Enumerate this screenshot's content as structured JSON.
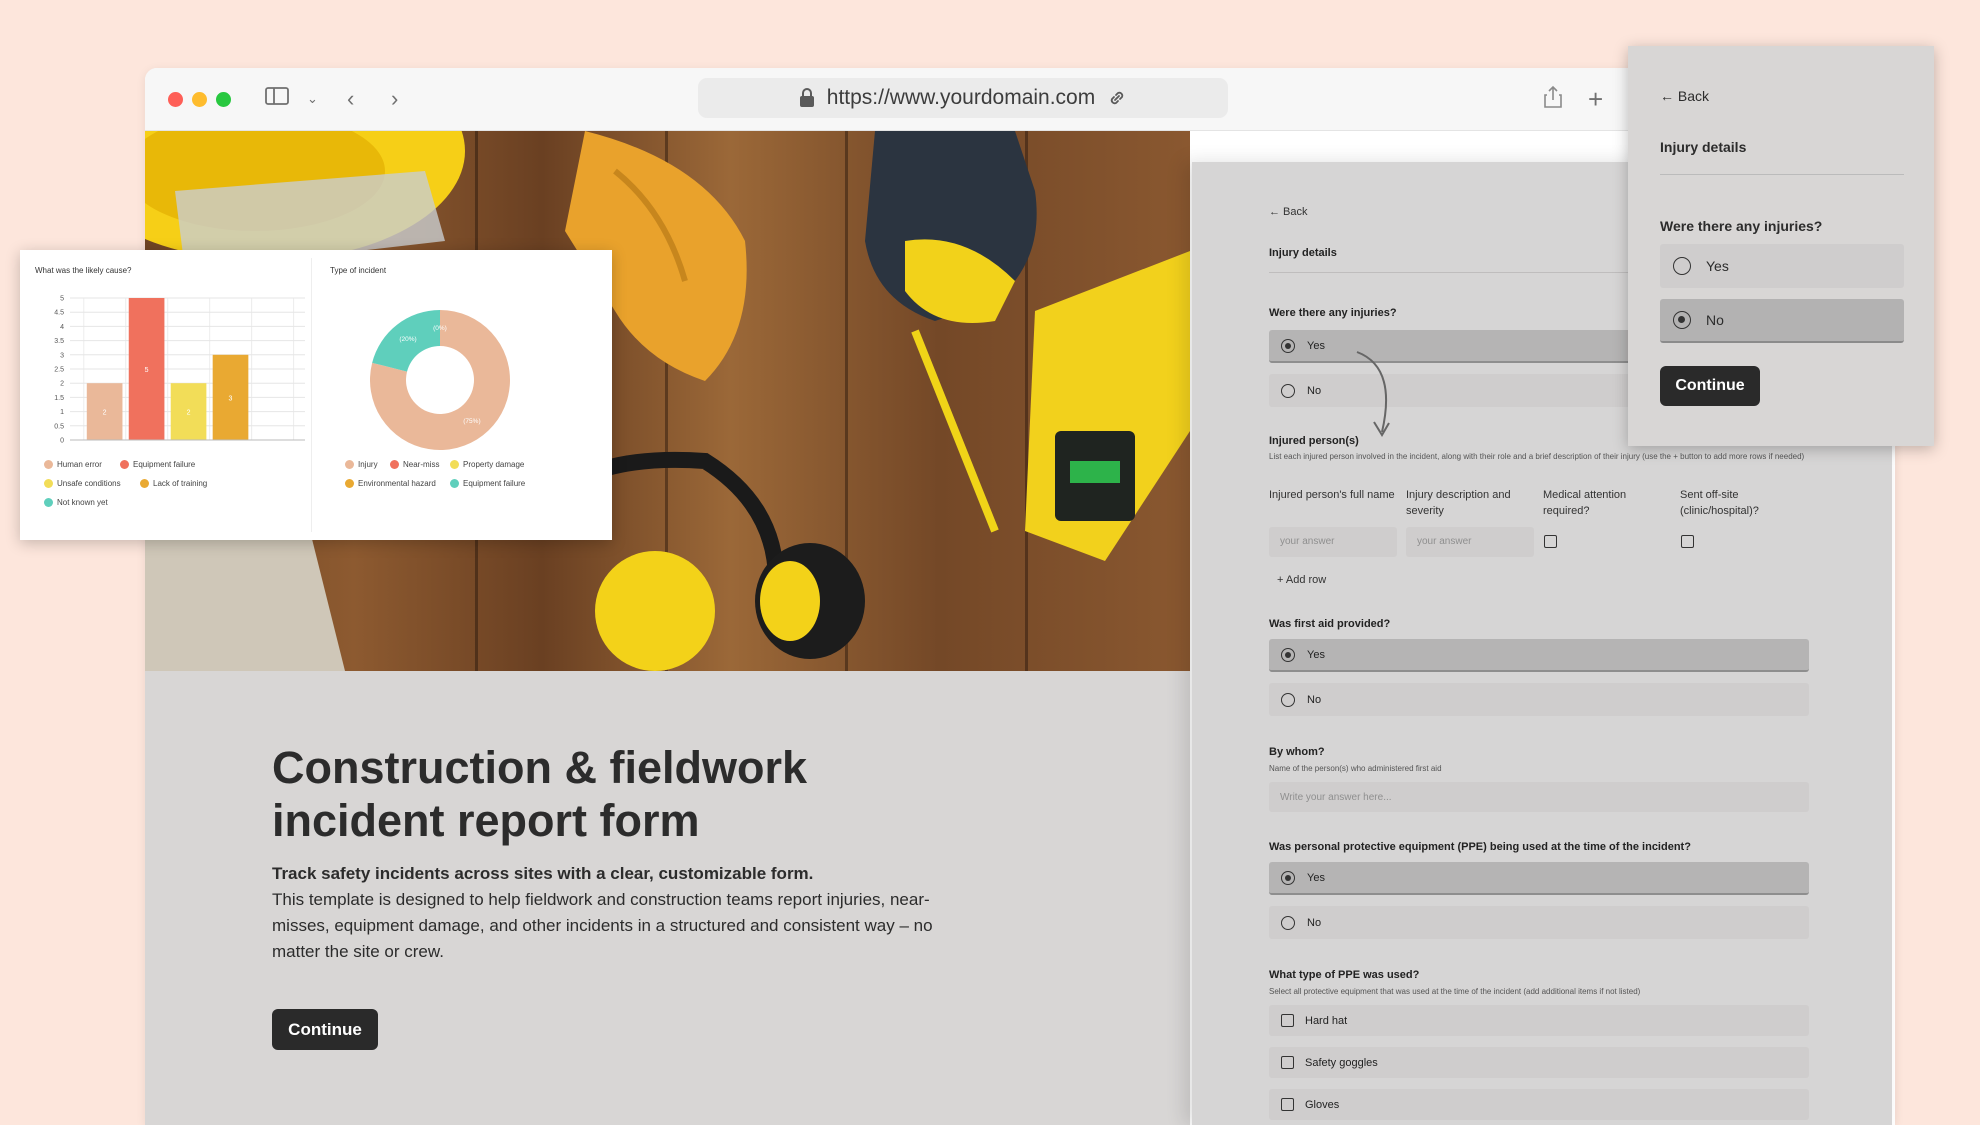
{
  "browser": {
    "url": "https://www.yourdomain.com"
  },
  "landing": {
    "title": "Construction & fieldwork incident report form",
    "subtitle": "Track safety incidents across sites with a clear, customizable form.",
    "description": "This template is designed to help fieldwork and construction teams report injuries, near-misses, equipment damage, and other incidents in a structured and consistent way – no matter the site or crew.",
    "continue_label": "Continue"
  },
  "form": {
    "back_label": "← Back",
    "section_title": "Injury details",
    "q_injuries": "Were there any injuries?",
    "opt_yes": "Yes",
    "opt_no": "No",
    "q_injured_persons": "Injured person(s)",
    "injured_hint": "List each injured person involved in the incident, along with their role and a brief description of their injury (use the + button to add more rows if needed)",
    "columns": [
      "Injured person's full name",
      "Injury description and severity",
      "Medical attention required?",
      "Sent off-site (clinic/hospital)?"
    ],
    "input_placeholder": "your answer",
    "add_row_label": "+  Add row",
    "q_first_aid": "Was first aid provided?",
    "q_by_whom": "By whom?",
    "by_whom_hint": "Name of the person(s) who administered first aid",
    "by_whom_placeholder": "Write your answer here...",
    "q_ppe": "Was personal protective equipment (PPE) being used at the time of the incident?",
    "q_ppe_type": "What type of PPE was used?",
    "ppe_type_hint": "Select all protective equipment that was used at the time of the incident (add additional items if not listed)",
    "ppe_options": [
      "Hard hat",
      "Safety goggles",
      "Gloves"
    ]
  },
  "popup": {
    "back_label": "← Back",
    "section_title": "Injury details",
    "question": "Were there any injuries?",
    "opt_yes": "Yes",
    "opt_no": "No",
    "selected": "No",
    "continue_label": "Continue"
  },
  "colors": {
    "human_error": "#eab899",
    "equipment_failure": "#f0715d",
    "unsafe_conditions": "#f2dd58",
    "lack_of_training": "#e9a932",
    "not_known_yet": "#5fcfbc"
  },
  "chart_data": [
    {
      "type": "bar",
      "title": "What was the likely cause?",
      "categories": [
        "Human error",
        "Equipment failure",
        "Unsafe conditions",
        "Lack of training"
      ],
      "values": [
        2,
        5,
        2,
        3
      ],
      "ylim": [
        0,
        5
      ],
      "yticks": [
        "0",
        "0.5",
        "1",
        "1.5",
        "2",
        "2.5",
        "3",
        "3.5",
        "4",
        "4.5",
        "5"
      ],
      "legend": [
        "Human error",
        "Equipment failure",
        "Unsafe conditions",
        "Lack of training",
        "Not known yet"
      ],
      "grid": true
    },
    {
      "type": "pie",
      "title": "Type of incident",
      "slices": [
        {
          "name": "Injury",
          "value": 75,
          "label": "(75%)"
        },
        {
          "name": "Equipment failure",
          "value": 20,
          "label": "(20%)"
        },
        {
          "name": "Near-miss",
          "value": 0,
          "label": "(0%)"
        }
      ],
      "legend": [
        "Injury",
        "Near-miss",
        "Property damage",
        "Environmental hazard",
        "Equipment failure"
      ]
    }
  ]
}
